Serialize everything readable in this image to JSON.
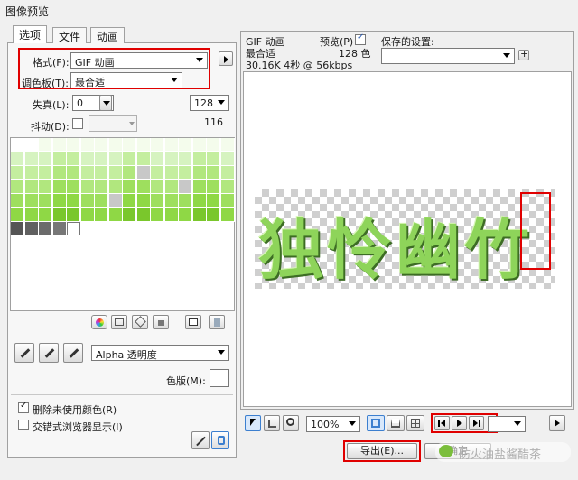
{
  "window": {
    "title": "图像预览"
  },
  "tabs": [
    {
      "label": "选项"
    },
    {
      "label": "文件"
    },
    {
      "label": "动画"
    }
  ],
  "format": {
    "label": "格式(F):",
    "value": "GIF 动画"
  },
  "palette": {
    "label": "调色板(T):",
    "value": "最合适"
  },
  "loss": {
    "label": "失真(L):",
    "value": "0"
  },
  "colors_count": {
    "value": "128",
    "sub": "116"
  },
  "dither": {
    "label": "抖动(D):"
  },
  "alpha": {
    "value": "Alpha 透明度"
  },
  "matte": {
    "label": "色版(M):"
  },
  "options": {
    "remove_unused": "删除未使用颜色(R)",
    "interlaced": "交错式浏览器显示(I)"
  },
  "preview_info": {
    "format": "GIF 动画",
    "palette": "最合适",
    "size": "30.16K 4秒 @ 56kbps",
    "preview_label": "预览(P)",
    "colors": "128 色"
  },
  "saved_settings": {
    "label": "保存的设置:"
  },
  "zoom": {
    "value": "100%"
  },
  "export_button": {
    "label": "导出(E)..."
  },
  "confirm_button": {
    "label": "确定"
  },
  "watermark": {
    "text": "防火油盐酱醋茶"
  },
  "artwork": {
    "text": "独怜幽竹"
  },
  "colors": {
    "greens": [
      "#e6f8d6",
      "#d6f3c0",
      "#c4ee9f",
      "#b1e77e",
      "#9edf5e",
      "#8fd845",
      "#7ac72c"
    ],
    "grays": [
      "#555555",
      "#606060",
      "#6b6b6b",
      "#777777"
    ]
  }
}
